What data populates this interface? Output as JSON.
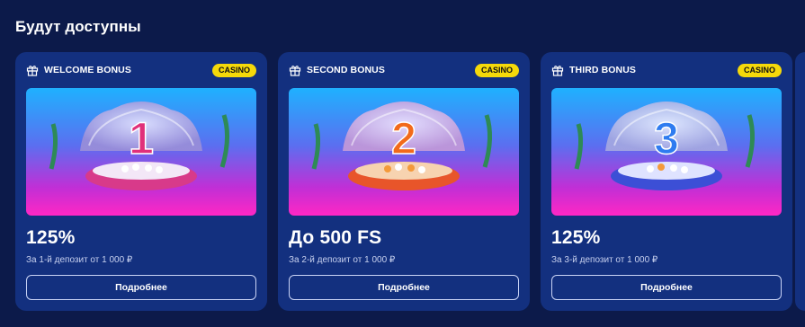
{
  "section": {
    "title": "Будут доступны"
  },
  "cards": [
    {
      "name": "WELCOME BONUS",
      "badge": "CASINO",
      "digit": "1",
      "amount": "125%",
      "condition": "За 1-й депозит от 1 000 ₽",
      "button": "Подробнее",
      "digit_color": "#e0307a"
    },
    {
      "name": "SECOND BONUS",
      "badge": "CASINO",
      "digit": "2",
      "amount": "До 500 FS",
      "condition": "За 2-й депозит от 1 000 ₽",
      "button": "Подробнее",
      "digit_color": "#f26a1b"
    },
    {
      "name": "THIRD BONUS",
      "badge": "CASINO",
      "digit": "3",
      "amount": "125%",
      "condition": "За 3-й депозит от 1 000 ₽",
      "button": "Подробнее",
      "digit_color": "#2f7cf0"
    }
  ],
  "icons": {
    "card_icon": "gift-icon"
  },
  "colors": {
    "background": "#0c1a4a",
    "card": "#13307f",
    "badge": "#f5d90a"
  }
}
